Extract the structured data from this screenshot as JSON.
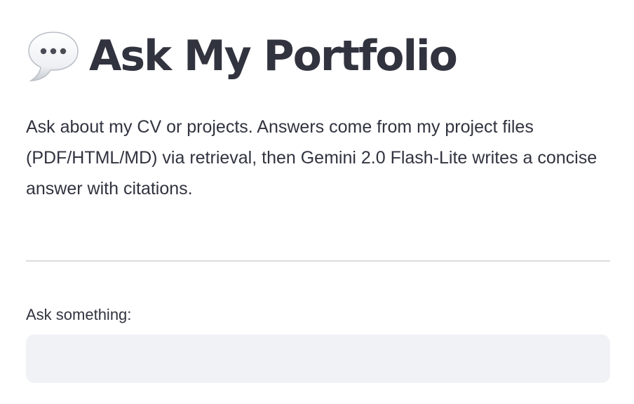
{
  "header": {
    "icon": "speech-bubble-icon",
    "title": "Ask My Portfolio"
  },
  "intro": {
    "text": "Ask about my CV or projects. Answers come from my project files (PDF/HTML/MD) via retrieval, then Gemini 2.0 Flash-Lite writes a concise answer with citations."
  },
  "question_input": {
    "label": "Ask something:",
    "value": "",
    "placeholder": ""
  },
  "colors": {
    "text": "#31333f",
    "input_background": "#f0f2f6",
    "divider": "#dcdcdf"
  }
}
